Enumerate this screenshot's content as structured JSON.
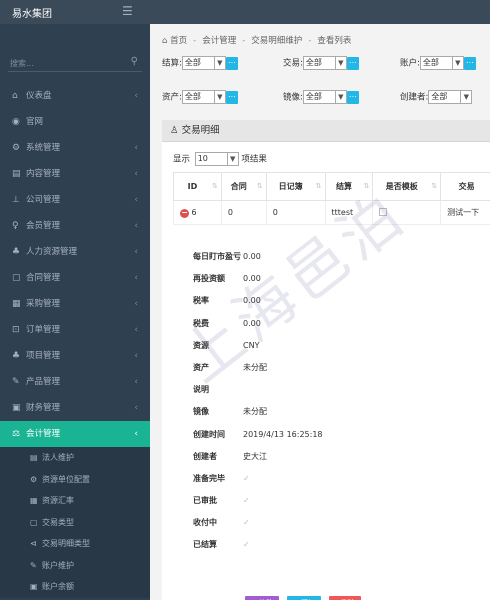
{
  "header": {
    "brand": "易水集团"
  },
  "sidebar": {
    "search_placeholder": "搜索...",
    "items": [
      {
        "label": "仪表盘",
        "icon": "home-icon"
      },
      {
        "label": "官网",
        "icon": "globe-icon"
      },
      {
        "label": "系统管理",
        "icon": "gears-icon"
      },
      {
        "label": "内容管理",
        "icon": "doc-icon"
      },
      {
        "label": "公司管理",
        "icon": "sitemap-icon"
      },
      {
        "label": "会员管理",
        "icon": "user-icon"
      },
      {
        "label": "人力资源管理",
        "icon": "group-icon"
      },
      {
        "label": "合同管理",
        "icon": "contract-icon"
      },
      {
        "label": "采购管理",
        "icon": "cart-icon"
      },
      {
        "label": "订单管理",
        "icon": "order-icon"
      },
      {
        "label": "项目管理",
        "icon": "project-icon"
      },
      {
        "label": "产品管理",
        "icon": "product-icon"
      },
      {
        "label": "财务管理",
        "icon": "money-icon"
      },
      {
        "label": "会计管理",
        "icon": "scale-icon"
      }
    ],
    "sub_items": [
      "法人维护",
      "资源单位配置",
      "资源汇率",
      "交易类型",
      "交易明细类型",
      "账户维护",
      "账户余额"
    ]
  },
  "breadcrumb": [
    "首页",
    "会计管理",
    "交易明细维护",
    "查看列表"
  ],
  "filters": {
    "settle": {
      "label": "结算:",
      "value": "全部"
    },
    "trade": {
      "label": "交易:",
      "value": "全部"
    },
    "account": {
      "label": "账户:",
      "value": "全部"
    },
    "asset": {
      "label": "资产:",
      "value": "全部"
    },
    "mirror": {
      "label": "镜像:",
      "value": "全部"
    },
    "creator": {
      "label": "创建者:",
      "value": "全部"
    },
    "more_btn": "..."
  },
  "panel": {
    "title": "交易明细",
    "show_label": "显示",
    "page_size": "10",
    "items_label": "项结果"
  },
  "table": {
    "columns": [
      "ID",
      "合同",
      "日记簿",
      "结算",
      "是否模板",
      "交易"
    ],
    "row": {
      "id": "6",
      "contract": "0",
      "journal": "0",
      "settle": "tttest",
      "trade": "测试一下"
    }
  },
  "detail": [
    {
      "label": "每日盯市盈亏",
      "value": "0.00"
    },
    {
      "label": "再投资额",
      "value": "0.00"
    },
    {
      "label": "税率",
      "value": "0.00"
    },
    {
      "label": "税费",
      "value": "0.00"
    },
    {
      "label": "资源",
      "value": "CNY"
    },
    {
      "label": "资产",
      "value": "未分配"
    },
    {
      "label": "说明",
      "value": ""
    },
    {
      "label": "镜像",
      "value": "未分配"
    },
    {
      "label": "创建时间",
      "value": "2019/4/13 16:25:18"
    },
    {
      "label": "创建者",
      "value": "史大江"
    },
    {
      "label": "准备完毕",
      "value": "✓"
    },
    {
      "label": "已审批",
      "value": "✓"
    },
    {
      "label": "收付中",
      "value": "✓"
    },
    {
      "label": "已结算",
      "value": "✓"
    }
  ],
  "actions": {
    "edit": "修改",
    "add": "添加",
    "delete": "删除"
  },
  "watermark": "上海邑泊"
}
